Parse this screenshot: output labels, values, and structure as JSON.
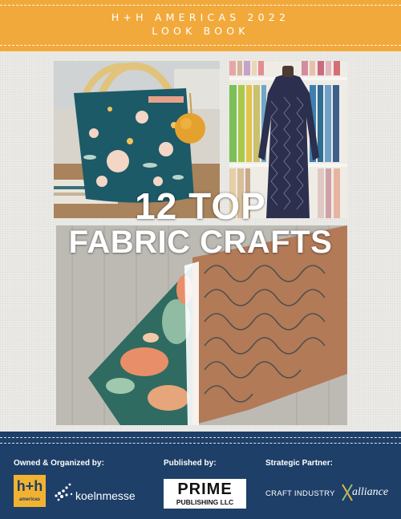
{
  "header": {
    "title_line1": "H+H AMERICAS 2022",
    "title_line2": "LOOK BOOK",
    "color": "#f2a93b"
  },
  "headline": {
    "line1": "12 TOP",
    "line2": "FABRIC CRAFTS"
  },
  "photos": [
    {
      "name": "floral tote bag with pom-pom"
    },
    {
      "name": "patterned dress on mannequin"
    },
    {
      "name": "folded tropical and geometric fabrics"
    }
  ],
  "footer": {
    "color": "#1d3f68",
    "owned_label": "Owned & Organized by:",
    "published_label": "Published by:",
    "partner_label": "Strategic Partner:",
    "hh_logo_main": "h+h",
    "hh_logo_sub": "americas",
    "koeln_logo": "koelnmesse",
    "prime_logo_main": "PRIME",
    "prime_logo_sub": "PUBLISHING LLC",
    "cia_logo_text": "CRAFT INDUSTRY",
    "cia_logo_script": "alliance"
  }
}
